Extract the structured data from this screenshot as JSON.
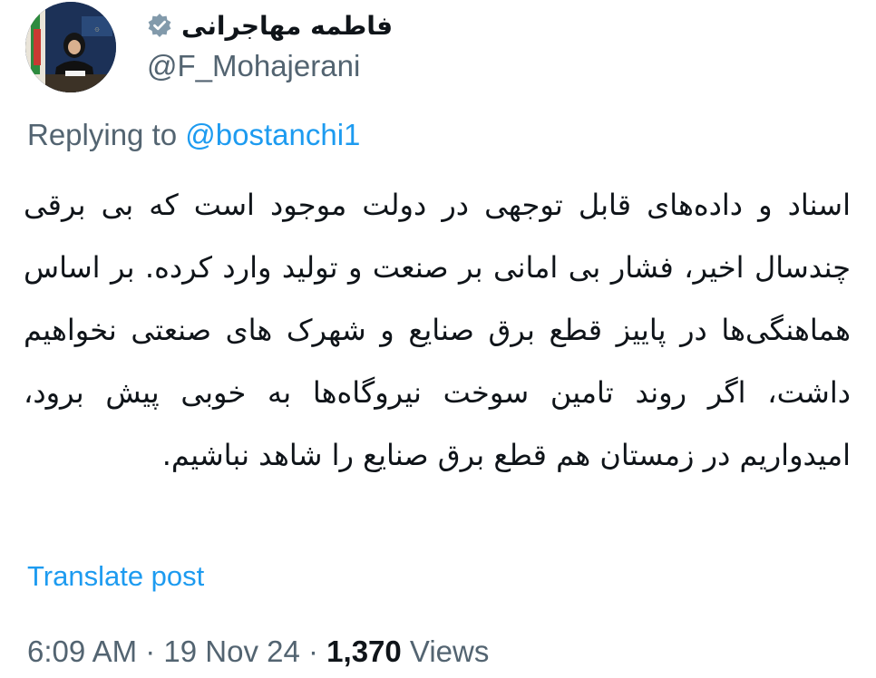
{
  "author": {
    "display_name": "فاطمه مهاجرانی",
    "handle": "@F_Mohajerani",
    "verified": true,
    "avatar_icon": "profile-photo"
  },
  "reply": {
    "prefix": "Replying to ",
    "mention": "@bostanchi1"
  },
  "tweet": {
    "text": "اسناد و داده‌های قابل توجهی در دولت موجود است که بی برقی چندسال اخیر، فشار بی امانی بر صنعت و تولید وارد کرده. بر اساس هماهنگی‌ها در پاییز قطع برق صنایع و شهرک های صنعتی نخواهیم داشت، اگر روند تامین سوخت نیروگاه‌ها به خوبی پیش برود، امیدواریم در زمستان هم قطع برق صنایع را شاهد نباشیم."
  },
  "translate_label": "Translate post",
  "meta": {
    "time": "6:09 AM",
    "separator": " · ",
    "date": "19 Nov 24",
    "views_count": "1,370",
    "views_label": " Views"
  },
  "colors": {
    "text": "#0f1419",
    "secondary": "#536471",
    "link": "#1d9bf0",
    "verified": "#829aab"
  }
}
